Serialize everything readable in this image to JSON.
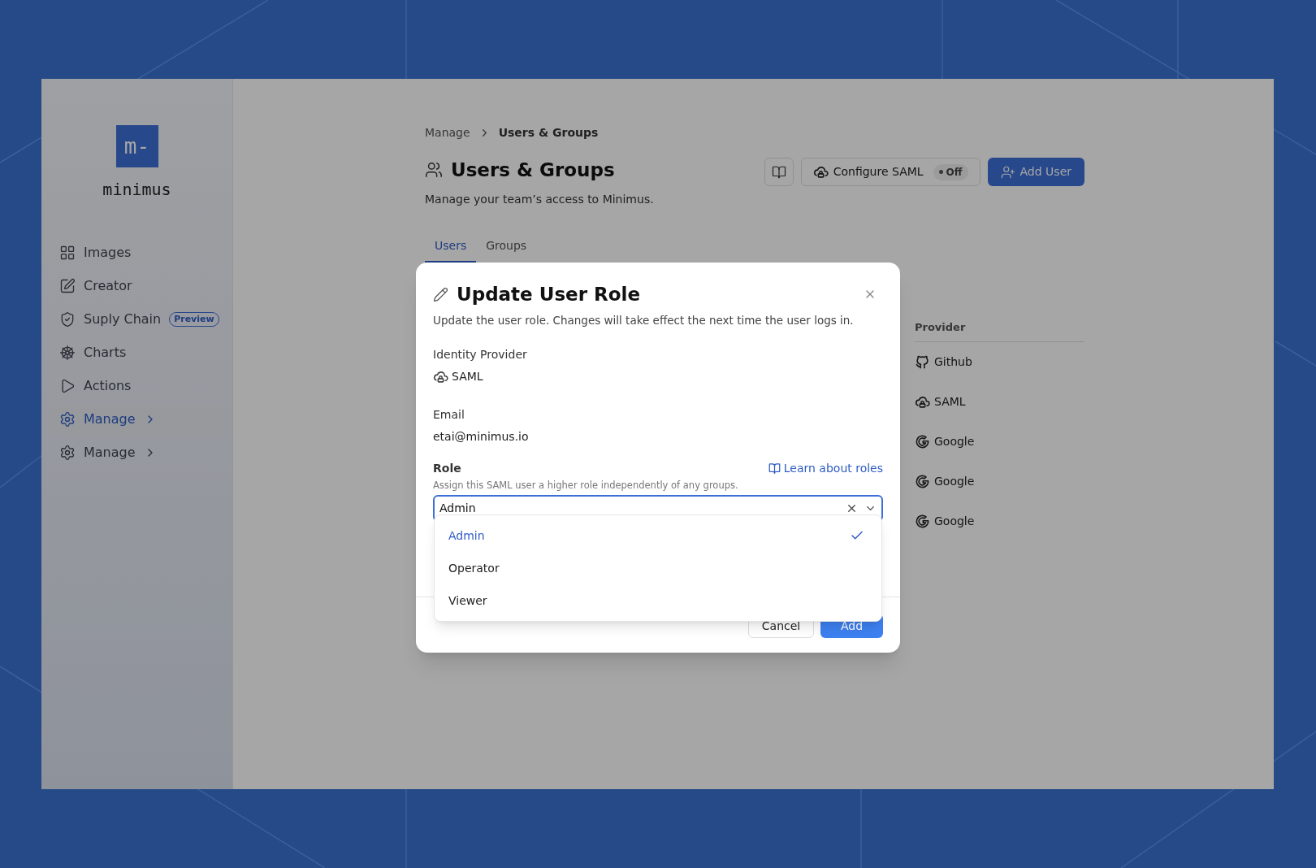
{
  "sidebar": {
    "logo_mark": "m-",
    "logo_text": "minimus",
    "items": [
      {
        "label": "Images",
        "selected": false
      },
      {
        "label": "Creator",
        "selected": false
      },
      {
        "label": "Suply Chain",
        "selected": false,
        "badge": "Preview"
      },
      {
        "label": "Charts",
        "selected": false
      },
      {
        "label": "Actions",
        "selected": false
      },
      {
        "label": "Manage",
        "selected": true,
        "chevron": true
      },
      {
        "label": "Manage",
        "selected": false,
        "chevron": true
      }
    ]
  },
  "breadcrumb": [
    "Manage",
    "Users & Groups"
  ],
  "page": {
    "title": "Users & Groups",
    "subtitle": "Manage your team’s access to Minimus.",
    "saml_button": {
      "label": "Configure SAML",
      "status": "Off",
      "on": false
    },
    "add_button": "Add User"
  },
  "tabs": [
    {
      "label": "Users",
      "selected": true
    },
    {
      "label": "Groups",
      "selected": false
    }
  ],
  "table": {
    "column": "Provider",
    "rows": [
      {
        "provider": "Github",
        "kind": "github"
      },
      {
        "provider": "SAML",
        "kind": "saml"
      },
      {
        "provider": "Google",
        "kind": "google"
      },
      {
        "provider": "Google",
        "kind": "google"
      },
      {
        "provider": "Google",
        "kind": "google"
      }
    ]
  },
  "dialog": {
    "title": "Update User Role",
    "description": "Update the user role. Changes will take effect the next time the user logs in.",
    "identity_label": "Identity Provider",
    "identity_value": "SAML",
    "email_label": "Email",
    "email_value": "etai@minimus.io",
    "role_label": "Role",
    "role_help": "Assign this SAML user a higher role independently of any groups.",
    "learn_link": "Learn about roles",
    "role_value": "Admin",
    "options": [
      {
        "label": "Admin",
        "selected": true
      },
      {
        "label": "Operator",
        "selected": false
      },
      {
        "label": "Viewer",
        "selected": false
      }
    ],
    "cancel": "Cancel",
    "submit": "Add"
  }
}
